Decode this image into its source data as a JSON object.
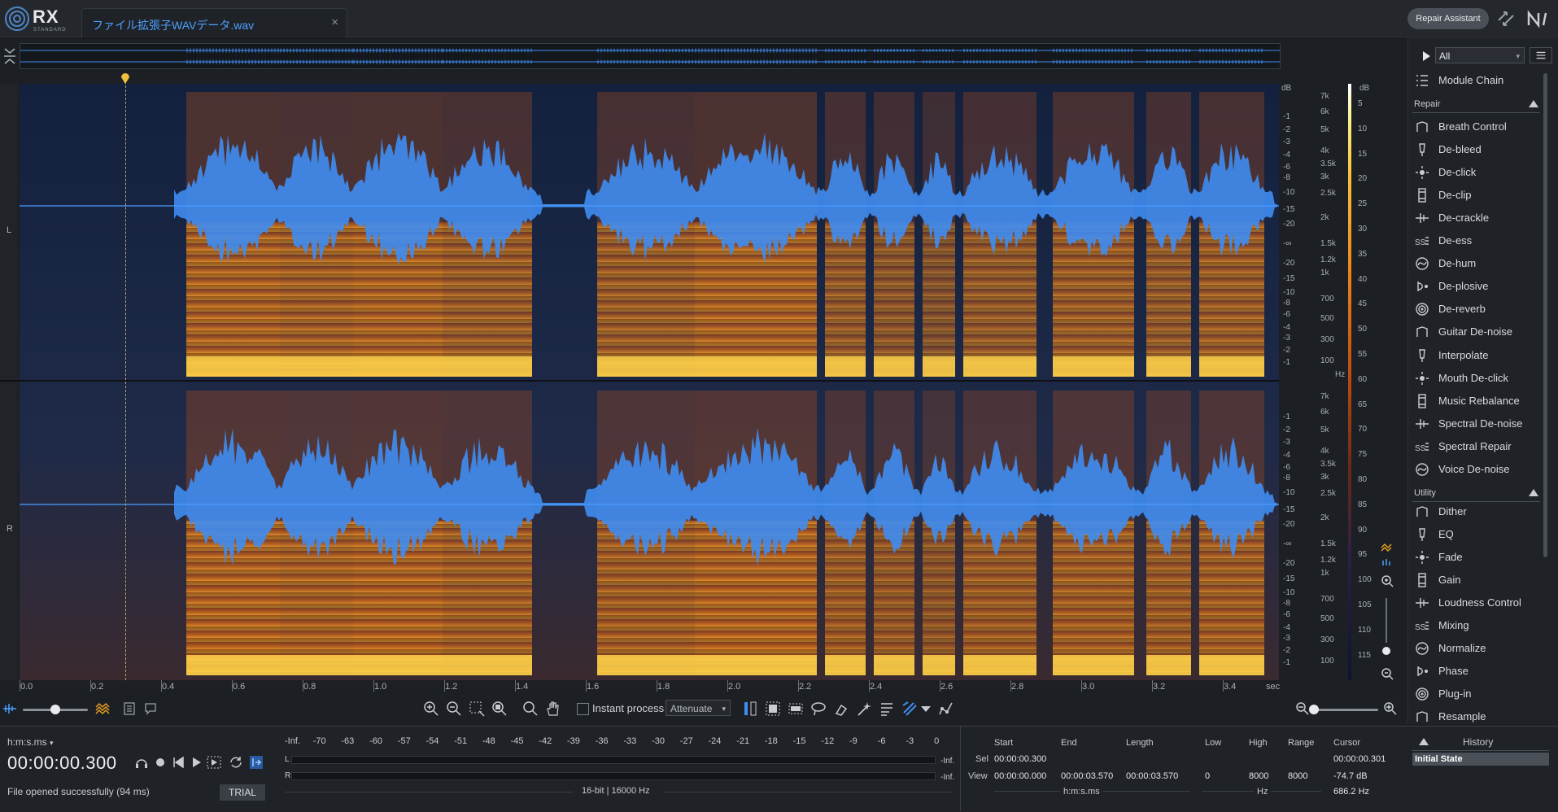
{
  "app": {
    "logo_text": "RX",
    "edition": "STANDARD",
    "file_tab": "ファイル拡張子WAVデータ.wav",
    "close_glyph": "×"
  },
  "header": {
    "repair_assistant": "Repair Assistant"
  },
  "channels": {
    "left": "L",
    "right": "R"
  },
  "db_scale": {
    "unit": "dB",
    "left_ticks": [
      "-1",
      "-2",
      "-3",
      "-4",
      "-6",
      "-8",
      "-10",
      "-15",
      "-20",
      "-∞",
      "-20",
      "-15",
      "-10",
      "-8",
      "-6",
      "-4",
      "-3",
      "-2",
      "-1"
    ],
    "right_ticks": [
      "-1",
      "-2",
      "-3",
      "-4",
      "-6",
      "-8",
      "-10",
      "-15",
      "-20",
      "-∞",
      "-20",
      "-15",
      "-10",
      "-8",
      "-6",
      "-4",
      "-3",
      "-2",
      "-1"
    ]
  },
  "hz_scale": {
    "unit": "Hz",
    "ticks": [
      "7k",
      "6k",
      "5k",
      "4k",
      "3.5k",
      "3k",
      "2.5k",
      "2k",
      "1.5k",
      "1.2k",
      "1k",
      "700",
      "500",
      "300",
      "100"
    ]
  },
  "colorbar": {
    "unit": "dB",
    "ticks": [
      "5",
      "10",
      "15",
      "20",
      "25",
      "30",
      "35",
      "40",
      "45",
      "50",
      "55",
      "60",
      "65",
      "70",
      "75",
      "80",
      "85",
      "90",
      "95",
      "100",
      "105",
      "110",
      "115"
    ]
  },
  "ruler": {
    "ticks": [
      "0.0",
      "0.2",
      "0.4",
      "0.6",
      "0.8",
      "1.0",
      "1.2",
      "1.4",
      "1.6",
      "1.8",
      "2.0",
      "2.2",
      "2.4",
      "2.6",
      "2.8",
      "3.0",
      "3.2",
      "3.4"
    ],
    "unit": "sec"
  },
  "toolbar": {
    "instant_process": "Instant process",
    "attenuate": "Attenuate"
  },
  "transport": {
    "time_format": "h:m:s.ms",
    "timecode": "00:00:00.300"
  },
  "status": {
    "message": "File opened successfully (94 ms)",
    "trial": "TRIAL"
  },
  "meter": {
    "scale": [
      "-Inf.",
      "-70",
      "-63",
      "-60",
      "-57",
      "-54",
      "-51",
      "-48",
      "-45",
      "-42",
      "-39",
      "-36",
      "-33",
      "-30",
      "-27",
      "-24",
      "-21",
      "-18",
      "-15",
      "-12",
      "-9",
      "-6",
      "-3",
      "0"
    ],
    "l_label": "L",
    "r_label": "R",
    "l_value": "-Inf.",
    "r_value": "-Inf.",
    "format": "16-bit | 16000 Hz"
  },
  "selection": {
    "headers": {
      "start": "Start",
      "end": "End",
      "length": "Length",
      "low": "Low",
      "high": "High",
      "range": "Range",
      "cursor": "Cursor"
    },
    "sel_label": "Sel",
    "view_label": "View",
    "sel_start": "00:00:00.300",
    "view_start": "00:00:00.000",
    "view_end": "00:00:03.570",
    "view_length": "00:00:03.570",
    "low": "0",
    "high": "8000",
    "range": "8000",
    "time_unit": "h:m:s.ms",
    "freq_unit": "Hz",
    "cursor_time": "00:00:00.301",
    "cursor_db": "-74.7 dB",
    "cursor_hz": "686.2 Hz"
  },
  "modules": {
    "filter": "All",
    "module_chain": "Module Chain",
    "repair_header": "Repair",
    "repair": [
      "Breath Control",
      "De-bleed",
      "De-click",
      "De-clip",
      "De-crackle",
      "De-ess",
      "De-hum",
      "De-plosive",
      "De-reverb",
      "Guitar De-noise",
      "Interpolate",
      "Mouth De-click",
      "Music Rebalance",
      "Spectral De-noise",
      "Spectral Repair",
      "Voice De-noise"
    ],
    "utility_header": "Utility",
    "utility": [
      "Dither",
      "EQ",
      "Fade",
      "Gain",
      "Loudness Control",
      "Mixing",
      "Normalize",
      "Phase",
      "Plug-in",
      "Resample"
    ]
  },
  "history": {
    "title": "History",
    "items": [
      "Initial State"
    ]
  },
  "colors": {
    "accent": "#4ea0ff",
    "waveform": "#3f8df2",
    "spectrum_hot": "#f8b83a",
    "spectrum_cold": "#0e1830"
  }
}
